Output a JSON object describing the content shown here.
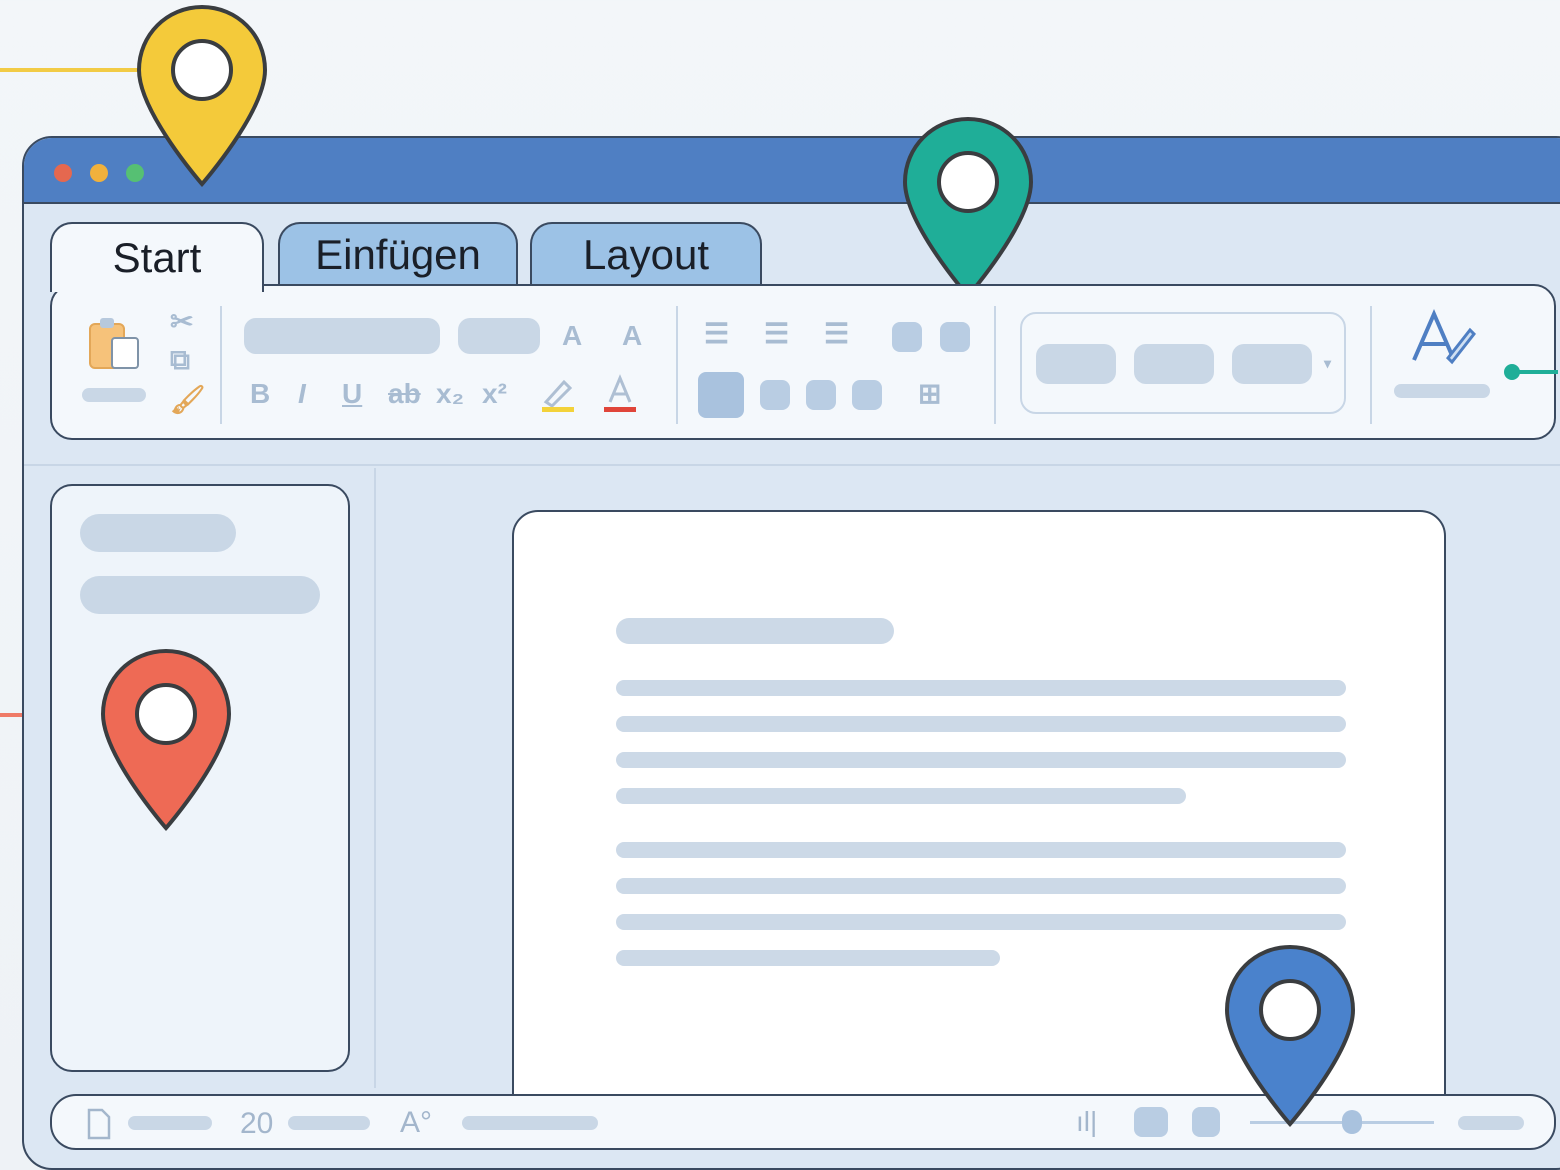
{
  "window": {
    "tabs": [
      {
        "label": "Start",
        "active": true
      },
      {
        "label": "Einfügen",
        "active": false
      },
      {
        "label": "Layout",
        "active": false
      }
    ]
  },
  "ribbon": {
    "icons": [
      "paste-icon",
      "cut-icon",
      "copy-icon",
      "format-painter-icon",
      "grow-font-icon",
      "shrink-font-icon",
      "bold-icon",
      "italic-icon",
      "underline-icon",
      "strikethrough-icon",
      "subscript-icon",
      "superscript-icon",
      "highlight-icon",
      "font-color-icon",
      "bullets-icon",
      "numbering-icon",
      "multilevel-list-icon",
      "styles-icon"
    ],
    "accent_colors": {
      "highlight": "#f3d23a",
      "font_color": "#e0453a"
    }
  },
  "statusbar": {
    "word_count": "20"
  },
  "markers": {
    "colors": {
      "yellow": "#f4ca3a",
      "teal": "#1fae98",
      "red": "#ee6a55",
      "blue": "#4a82cc"
    }
  }
}
